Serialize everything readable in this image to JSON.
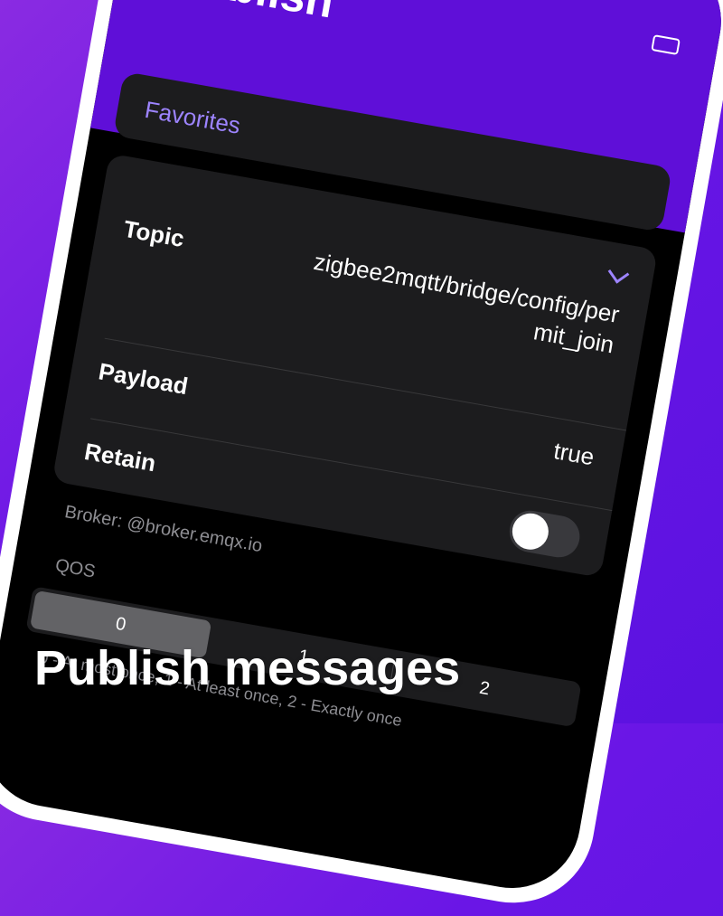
{
  "screen": {
    "title": "Publish",
    "favorites_label": "Favorites",
    "form": {
      "topic_label": "Topic",
      "topic_value": "zigbee2mqtt/bridge/config/permit_join",
      "payload_label": "Payload",
      "payload_value": "true",
      "retain_label": "Retain",
      "retain_on": false
    },
    "broker_text": "Broker: @broker.emqx.io",
    "qos": {
      "label": "QOS",
      "options": [
        "0",
        "1",
        "2"
      ],
      "selected": "0",
      "hint": "0 - At most once, 1 - At least once, 2 - Exactly once"
    }
  },
  "caption": "Publish messages",
  "colors": {
    "brand_purple": "#5f0fd8",
    "accent": "#9d84ff",
    "card_background": "#1c1c1e",
    "screen_background": "#000000"
  }
}
